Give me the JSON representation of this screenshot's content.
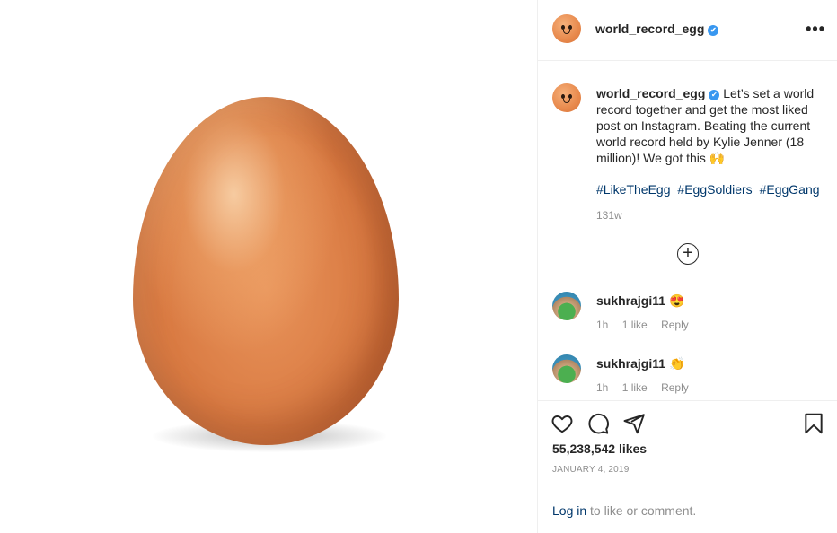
{
  "header": {
    "username": "world_record_egg",
    "verified_mark": "✔",
    "more_label": "•••"
  },
  "caption": {
    "username": "world_record_egg",
    "text": "Let’s set a world record together and get the most liked post on Instagram. Beating the current world record held by Kylie Jenner (18 million)! We got this 🙌",
    "hashtags": [
      "#LikeTheEgg",
      "#EggSoldiers",
      "#EggGang"
    ],
    "age": "131w"
  },
  "load_more_label": "+",
  "comments": [
    {
      "username": "sukhrajgi11",
      "text": "😍",
      "age": "1h",
      "likes": "1 like",
      "reply": "Reply"
    },
    {
      "username": "sukhrajgi11",
      "text": "👏",
      "age": "1h",
      "likes": "1 like",
      "reply": "Reply"
    }
  ],
  "actions": {
    "icons": [
      "heart-icon",
      "comment-icon",
      "share-icon",
      "bookmark-icon"
    ],
    "likes": "55,238,542 likes",
    "date": "JANUARY 4, 2019"
  },
  "login": {
    "link": "Log in",
    "rest": " to like or comment."
  },
  "colors": {
    "link": "#00376b",
    "verified": "#3897f0",
    "muted": "#8e8e8e",
    "border": "#efefef"
  }
}
